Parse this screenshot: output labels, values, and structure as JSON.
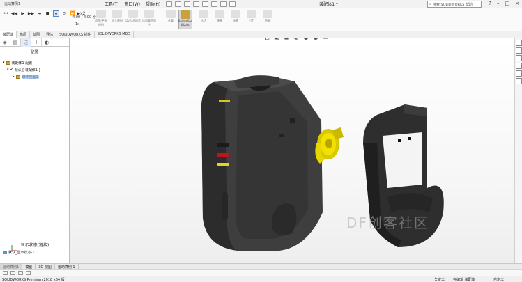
{
  "window": {
    "title_left": "运动算例1",
    "doc_title": "装配体1 *",
    "menu": [
      "工具(T)",
      "窗口(W)",
      "帮助(H)"
    ],
    "search_placeholder": "搜索 SOLIDWORKS 帮助",
    "winbtns": [
      "?",
      "–",
      "□",
      "×"
    ]
  },
  "toolbar": {
    "playback": [
      "⏮",
      "◀◀",
      "▶",
      "▶▶",
      "⏭",
      "■",
      "⏹",
      "⟳",
      "⏩",
      "▶x2"
    ],
    "speed_label": "4.00 / 4.00 秒",
    "speed_label2": "1x",
    "buttons": [
      "添加/更新键码",
      "插入键码",
      "DynaXpert",
      "运动算例属性",
      "计算",
      "马达",
      "弹簧",
      "接触",
      "引力",
      "结果",
      "Animation Wizard"
    ],
    "selected_button": "Animation Wizard"
  },
  "tabs": [
    "装配体",
    "布局",
    "草图",
    "评估",
    "SOLIDWORKS 插件",
    "SOLIDWORKS MBD"
  ],
  "left_panel": {
    "title": "配置",
    "tree": [
      {
        "label": "装配体1 配置",
        "indent": 0
      },
      {
        "label": "默认 [ 装配体1 ]",
        "indent": 1
      },
      {
        "label": "爆炸视图1",
        "indent": 2,
        "selected": true
      }
    ],
    "display_header": "显示状态(链接)",
    "display_item": "默认_显示状态-1"
  },
  "bottom_tabs": [
    "运动算例1",
    "模型",
    "3D 视图",
    "运动算例 1"
  ],
  "status": {
    "left": "SOLIDWORKS Premium 2018 x64 版",
    "right1": "欠定义",
    "right2": "在编辑 装配体",
    "right3": "自定义"
  },
  "watermark": "DF创客社区",
  "colors": {
    "accent": "#5a87c6",
    "housing": "#3a3a3a",
    "gear": "#f2e000",
    "red_stripe": "#c0141b",
    "yellow_stripe": "#e6d21c"
  }
}
